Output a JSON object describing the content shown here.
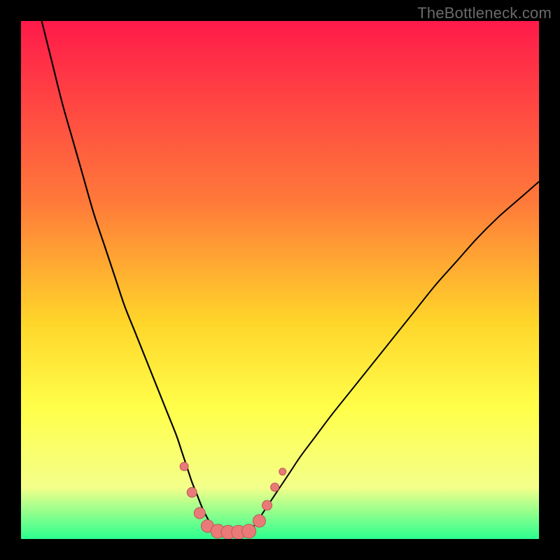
{
  "watermark": "TheBottleneck.com",
  "colors": {
    "black": "#000000",
    "curve": "#000000",
    "marker_fill": "#e97a78",
    "marker_stroke": "#bb5856",
    "grad_top": "#ff1a4a",
    "grad_mid1": "#ff7a3a",
    "grad_mid2": "#ffd52a",
    "grad_mid3": "#ffff4a",
    "grad_mid4": "#f4ff8a",
    "grad_bottom": "#2bff8f"
  },
  "chart_data": {
    "type": "line",
    "title": "",
    "xlabel": "",
    "ylabel": "",
    "xlim": [
      0,
      100
    ],
    "ylim": [
      0,
      100
    ],
    "series": [
      {
        "name": "left-curve",
        "x": [
          4,
          6,
          8,
          10,
          12,
          14,
          16,
          18,
          20,
          22,
          24,
          26,
          28,
          30,
          31,
          32,
          33,
          34,
          35,
          36,
          37
        ],
        "values": [
          100,
          92,
          84,
          77,
          70,
          63,
          57,
          51,
          45,
          40,
          35,
          30,
          25,
          20,
          17,
          14,
          11,
          8.5,
          6,
          4,
          2.5
        ]
      },
      {
        "name": "right-curve",
        "x": [
          45,
          46,
          47,
          48,
          50,
          52,
          54,
          57,
          60,
          64,
          68,
          72,
          76,
          80,
          84,
          88,
          92,
          96,
          100
        ],
        "values": [
          2.5,
          4,
          5.5,
          7,
          10,
          13,
          16,
          20,
          24,
          29,
          34,
          39,
          44,
          49,
          53.5,
          58,
          62,
          65.5,
          69
        ]
      }
    ],
    "floor_y": 1.5,
    "floor_x": [
      37,
      45
    ],
    "markers": [
      {
        "x": 31.5,
        "y": 14,
        "r": 6
      },
      {
        "x": 33.0,
        "y": 9,
        "r": 7
      },
      {
        "x": 34.5,
        "y": 5,
        "r": 8
      },
      {
        "x": 36.0,
        "y": 2.5,
        "r": 9
      },
      {
        "x": 38.0,
        "y": 1.5,
        "r": 10
      },
      {
        "x": 40.0,
        "y": 1.3,
        "r": 10
      },
      {
        "x": 42.0,
        "y": 1.3,
        "r": 10
      },
      {
        "x": 44.0,
        "y": 1.5,
        "r": 10
      },
      {
        "x": 46.0,
        "y": 3.5,
        "r": 9
      },
      {
        "x": 47.5,
        "y": 6.5,
        "r": 7
      },
      {
        "x": 49.0,
        "y": 10,
        "r": 6
      },
      {
        "x": 50.5,
        "y": 13,
        "r": 5
      }
    ]
  }
}
